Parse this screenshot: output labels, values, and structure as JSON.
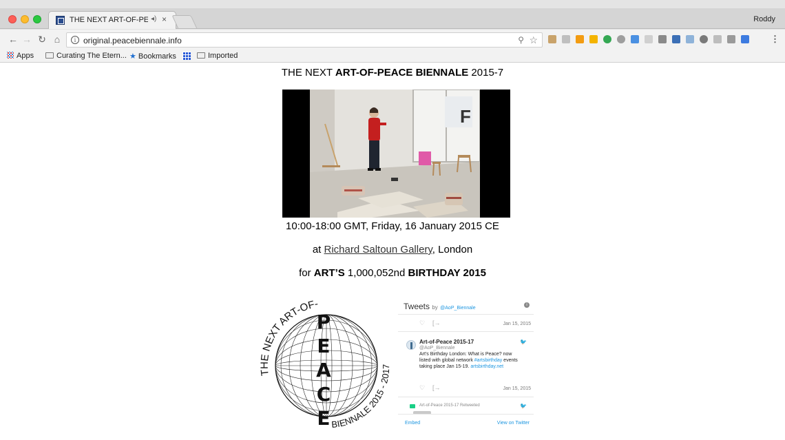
{
  "browser": {
    "tab_title": "THE NEXT ART-OF-PEACE",
    "tab_audio_icon": "speaker-icon",
    "tab_close": "×",
    "profile": "Roddy",
    "url": "original.peacebiennale.info",
    "bookmarks": [
      {
        "label": "Apps",
        "icon": "apps-icon"
      },
      {
        "label": "Curating The Etern...",
        "icon": "folder-icon"
      },
      {
        "label": "Bookmarks",
        "icon": "star-icon"
      },
      {
        "label": "",
        "icon": "grid-icon"
      },
      {
        "label": "Imported",
        "icon": "folder-icon"
      }
    ]
  },
  "page": {
    "heading_pre": "THE NEXT ",
    "heading_bold": "ART-OF-PEACE BIENNALE",
    "heading_post": " 2015-7",
    "time_line": "10:00-18:00 GMT, Friday, 16 January 2015 CE",
    "location_pre": "at ",
    "location_link": "Richard Saltoun Gallery",
    "location_post": ", London",
    "birthday_pre": "for ",
    "birthday_bold1": "ART’S",
    "birthday_mid": " 1,000,052nd ",
    "birthday_bold2": "BIRTHDAY 2015",
    "logo": {
      "arc_top": "THE NEXT ART-OF-",
      "letters": [
        "P",
        "E",
        "A",
        "C",
        "E"
      ],
      "arc_bottom": "BIENNALE 2015 - 2017"
    }
  },
  "twitter": {
    "title": "Tweets",
    "by": "by",
    "handle": "@AoP_Biennale",
    "tweet1_date": "Jan 15, 2015",
    "tweet2_name": "Art-of-Peace 2015-17",
    "tweet2_handle": "@AoP_Biennale",
    "tweet2_text_1": "Art's Birthday London: What is Peace? now listed with global network ",
    "tweet2_hashtag": "#artsbirthday",
    "tweet2_text_2": " events taking place Jan 15-19. ",
    "tweet2_link": "artsbirthday.net",
    "tweet2_date": "Jan 15, 2015",
    "retweeted_by": "Art-of-Peace 2015-17 Retweeted",
    "embed": "Embed",
    "view": "View on Twitter"
  }
}
